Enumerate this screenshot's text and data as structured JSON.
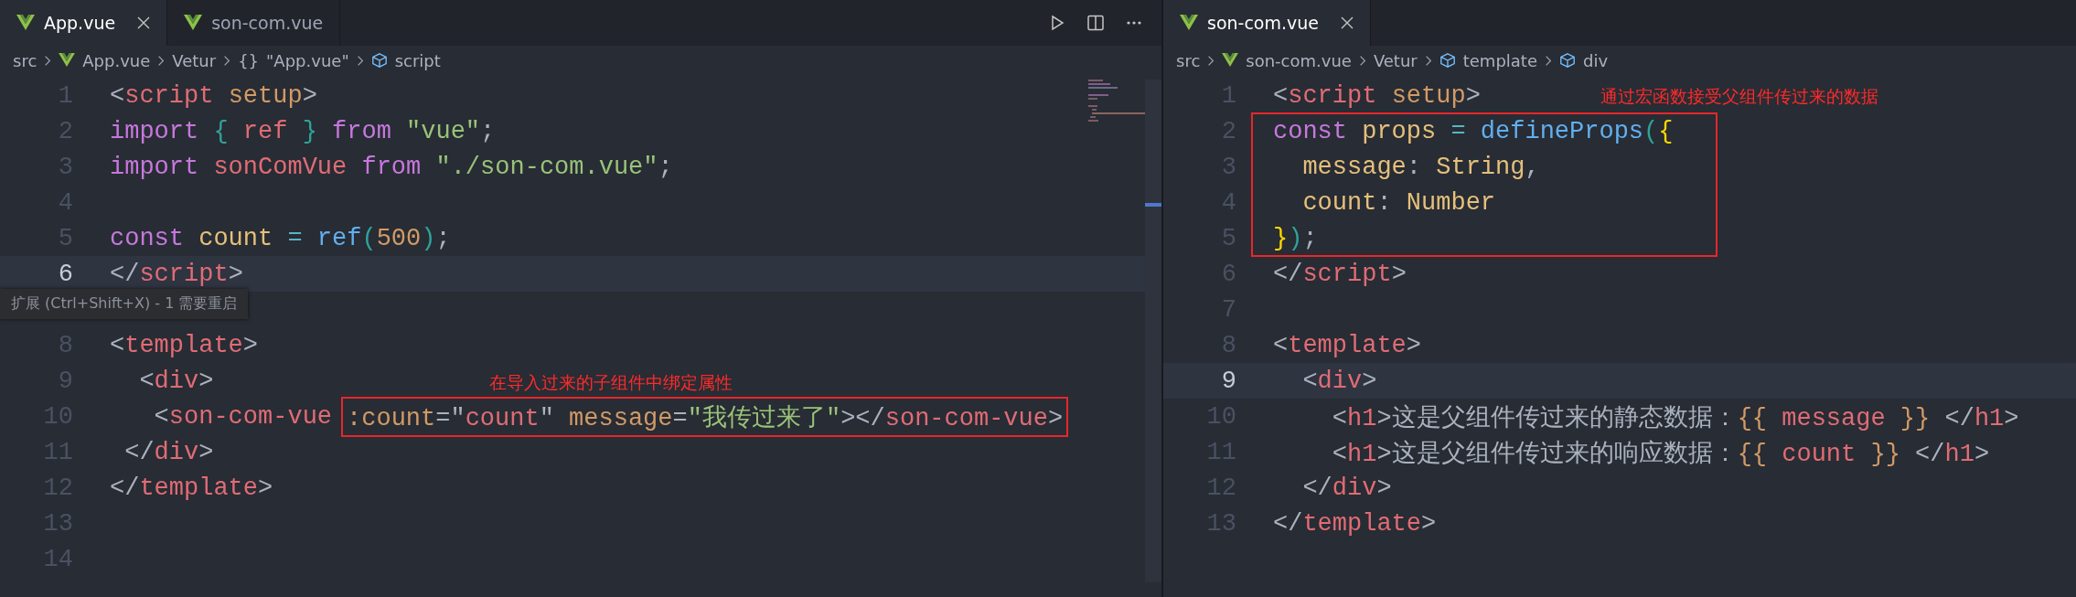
{
  "panes": [
    {
      "tabs": [
        {
          "label": "App.vue",
          "selected": true
        },
        {
          "label": "son-com.vue",
          "selected": false
        }
      ],
      "toolbar": true,
      "breadcrumbs": [
        {
          "kind": "folder",
          "text": "src"
        },
        {
          "kind": "file",
          "text": "App.vue"
        },
        {
          "kind": "plain",
          "text": "Vetur"
        },
        {
          "kind": "object",
          "glyph": "{}",
          "text": "\"App.vue\""
        },
        {
          "kind": "element",
          "text": "script"
        }
      ],
      "minimap": true,
      "tooltip": "扩展 (Ctrl+Shift+X) - 1 需要重启",
      "blocks": [
        {
          "lines": [
            {
              "number": "1",
              "current": false,
              "parts": [
                {
                  "tokens": [
                    {
                      "kind": "punct",
                      "text": "<"
                    },
                    {
                      "kind": "tag",
                      "text": "script "
                    },
                    {
                      "kind": "attr",
                      "text": "setup"
                    },
                    {
                      "kind": "punct",
                      "text": ">"
                    }
                  ]
                }
              ]
            },
            {
              "number": "2",
              "current": false,
              "parts": [
                {
                  "tokens": [
                    {
                      "kind": "keyword",
                      "text": "import "
                    },
                    {
                      "kind": "paren",
                      "text": "{ "
                    },
                    {
                      "kind": "tag",
                      "text": "ref "
                    },
                    {
                      "kind": "paren",
                      "text": "} "
                    },
                    {
                      "kind": "keyword",
                      "text": "from "
                    },
                    {
                      "kind": "string",
                      "text": "\"vue\""
                    },
                    {
                      "kind": "punct",
                      "text": ";"
                    }
                  ]
                }
              ]
            },
            {
              "number": "3",
              "current": false,
              "parts": [
                {
                  "tokens": [
                    {
                      "kind": "keyword",
                      "text": "import "
                    },
                    {
                      "kind": "tag",
                      "text": "sonComVue "
                    },
                    {
                      "kind": "keyword",
                      "text": "from "
                    },
                    {
                      "kind": "string",
                      "text": "\"./son-com.vue\""
                    },
                    {
                      "kind": "punct",
                      "text": ";"
                    }
                  ]
                }
              ]
            },
            {
              "number": "4",
              "current": false
            },
            {
              "number": "5",
              "current": false,
              "parts": [
                {
                  "tokens": [
                    {
                      "kind": "keyword",
                      "text": "const "
                    },
                    {
                      "kind": "var",
                      "text": "count "
                    },
                    {
                      "kind": "op",
                      "text": "= "
                    },
                    {
                      "kind": "func",
                      "text": "ref"
                    },
                    {
                      "kind": "paren",
                      "text": "("
                    },
                    {
                      "kind": "number",
                      "text": "500"
                    },
                    {
                      "kind": "paren",
                      "text": ")"
                    },
                    {
                      "kind": "punct",
                      "text": ";"
                    }
                  ]
                }
              ]
            },
            {
              "number": "6",
              "current": true,
              "parts": [
                {
                  "tokens": [
                    {
                      "kind": "punct",
                      "text": "</"
                    },
                    {
                      "kind": "tag",
                      "text": "script"
                    },
                    {
                      "kind": "punct",
                      "text": ">"
                    }
                  ]
                }
              ]
            },
            {
              "current": false
            },
            {
              "number": "8",
              "current": false,
              "parts": [
                {
                  "tokens": [
                    {
                      "kind": "punct",
                      "text": "<"
                    },
                    {
                      "kind": "tag",
                      "text": "template"
                    },
                    {
                      "kind": "punct",
                      "text": ">"
                    }
                  ]
                }
              ]
            },
            {
              "number": "9",
              "current": false,
              "parts": [
                {
                  "tokens": [
                    {
                      "kind": "punct",
                      "text": "  <"
                    },
                    {
                      "kind": "tag",
                      "text": "div"
                    },
                    {
                      "kind": "punct",
                      "text": ">"
                    }
                  ]
                }
              ]
            },
            {
              "number": "10",
              "current": false,
              "parts": [
                {
                  "tokens": [
                    {
                      "kind": "punct",
                      "text": "   <"
                    },
                    {
                      "kind": "tag",
                      "text": "son-com-vue"
                    }
                  ]
                },
                {
                  "boxed": true,
                  "note": "在导入过来的子组件中绑定属性",
                  "tokens": [
                    {
                      "kind": "attr",
                      "text": ":count"
                    },
                    {
                      "kind": "punct",
                      "text": "=\""
                    },
                    {
                      "kind": "tag",
                      "text": "count"
                    },
                    {
                      "kind": "punct",
                      "text": "\" "
                    },
                    {
                      "kind": "attr",
                      "text": "message"
                    },
                    {
                      "kind": "punct",
                      "text": "="
                    },
                    {
                      "kind": "string",
                      "text": "\"我传过来了\""
                    },
                    {
                      "kind": "punct",
                      "text": "></"
                    },
                    {
                      "kind": "tag",
                      "text": "son-com-vue"
                    },
                    {
                      "kind": "punct",
                      "text": ">"
                    }
                  ]
                }
              ]
            },
            {
              "number": "11",
              "current": false,
              "parts": [
                {
                  "tokens": [
                    {
                      "kind": "punct",
                      "text": " </"
                    },
                    {
                      "kind": "tag",
                      "text": "div"
                    },
                    {
                      "kind": "punct",
                      "text": ">"
                    }
                  ]
                }
              ]
            },
            {
              "number": "12",
              "current": false,
              "parts": [
                {
                  "tokens": [
                    {
                      "kind": "punct",
                      "text": "</"
                    },
                    {
                      "kind": "tag",
                      "text": "template"
                    },
                    {
                      "kind": "punct",
                      "text": ">"
                    }
                  ]
                }
              ]
            },
            {
              "number": "13",
              "current": false
            },
            {
              "number": "14",
              "current": false
            }
          ]
        }
      ]
    },
    {
      "tabs": [
        {
          "label": "son-com.vue",
          "selected": true
        }
      ],
      "breadcrumbs": [
        {
          "kind": "folder",
          "text": "src"
        },
        {
          "kind": "file",
          "text": "son-com.vue"
        },
        {
          "kind": "plain",
          "text": "Vetur"
        },
        {
          "kind": "element",
          "text": "template"
        },
        {
          "kind": "element",
          "text": "div"
        }
      ],
      "blocks": [
        {
          "lines": [
            {
              "number": "1",
              "current": false,
              "parts": [
                {
                  "tokens": [
                    {
                      "kind": "punct",
                      "text": "<"
                    },
                    {
                      "kind": "tag",
                      "text": "script "
                    },
                    {
                      "kind": "attr",
                      "text": "setup"
                    },
                    {
                      "kind": "punct",
                      "text": ">"
                    }
                  ]
                }
              ]
            }
          ]
        },
        {
          "boxed": true,
          "note": "通过宏函数接受父组件传过来的数据",
          "lines": [
            {
              "number": "2",
              "current": false,
              "parts": [
                {
                  "tokens": [
                    {
                      "kind": "keyword",
                      "text": "const "
                    },
                    {
                      "kind": "var",
                      "text": "props "
                    },
                    {
                      "kind": "op",
                      "text": "= "
                    },
                    {
                      "kind": "func",
                      "text": "defineProps"
                    },
                    {
                      "kind": "paren",
                      "text": "("
                    },
                    {
                      "kind": "brace",
                      "text": "{"
                    }
                  ]
                }
              ]
            },
            {
              "number": "3",
              "current": false,
              "parts": [
                {
                  "tokens": [
                    {
                      "kind": "var",
                      "text": "  message"
                    },
                    {
                      "kind": "punct",
                      "text": ": "
                    },
                    {
                      "kind": "var",
                      "text": "String"
                    },
                    {
                      "kind": "punct",
                      "text": ","
                    }
                  ]
                }
              ]
            },
            {
              "number": "4",
              "current": false,
              "parts": [
                {
                  "tokens": [
                    {
                      "kind": "var",
                      "text": "  count"
                    },
                    {
                      "kind": "punct",
                      "text": ": "
                    },
                    {
                      "kind": "var",
                      "text": "Number"
                    }
                  ]
                }
              ]
            },
            {
              "number": "5",
              "current": false,
              "parts": [
                {
                  "tokens": [
                    {
                      "kind": "brace",
                      "text": "}"
                    },
                    {
                      "kind": "paren",
                      "text": ")"
                    },
                    {
                      "kind": "punct",
                      "text": ";"
                    }
                  ]
                }
              ]
            }
          ]
        },
        {
          "lines": [
            {
              "number": "6",
              "current": false,
              "parts": [
                {
                  "tokens": [
                    {
                      "kind": "punct",
                      "text": "</"
                    },
                    {
                      "kind": "tag",
                      "text": "script"
                    },
                    {
                      "kind": "punct",
                      "text": ">"
                    }
                  ]
                }
              ]
            },
            {
              "number": "7",
              "current": false
            },
            {
              "number": "8",
              "current": false,
              "parts": [
                {
                  "tokens": [
                    {
                      "kind": "punct",
                      "text": "<"
                    },
                    {
                      "kind": "tag",
                      "text": "template"
                    },
                    {
                      "kind": "punct",
                      "text": ">"
                    }
                  ]
                }
              ]
            },
            {
              "number": "9",
              "current": true,
              "parts": [
                {
                  "tokens": [
                    {
                      "kind": "punct",
                      "text": "  <"
                    },
                    {
                      "kind": "tag",
                      "text": "div"
                    },
                    {
                      "kind": "punct",
                      "text": ">"
                    }
                  ]
                }
              ]
            },
            {
              "number": "10",
              "current": false,
              "parts": [
                {
                  "tokens": [
                    {
                      "kind": "punct",
                      "text": "    <"
                    },
                    {
                      "kind": "tag",
                      "text": "h1"
                    },
                    {
                      "kind": "punct",
                      "text": ">这是父组件传过来的静态数据："
                    },
                    {
                      "kind": "mustache",
                      "text": "{{ "
                    },
                    {
                      "kind": "tag",
                      "text": "message "
                    },
                    {
                      "kind": "mustache",
                      "text": "}} "
                    },
                    {
                      "kind": "punct",
                      "text": "</"
                    },
                    {
                      "kind": "tag",
                      "text": "h1"
                    },
                    {
                      "kind": "punct",
                      "text": ">"
                    }
                  ]
                }
              ]
            },
            {
              "number": "11",
              "current": false,
              "parts": [
                {
                  "tokens": [
                    {
                      "kind": "punct",
                      "text": "    <"
                    },
                    {
                      "kind": "tag",
                      "text": "h1"
                    },
                    {
                      "kind": "punct",
                      "text": ">这是父组件传过来的响应数据："
                    },
                    {
                      "kind": "mustache",
                      "text": "{{ "
                    },
                    {
                      "kind": "tag",
                      "text": "count "
                    },
                    {
                      "kind": "mustache",
                      "text": "}} "
                    },
                    {
                      "kind": "punct",
                      "text": "</"
                    },
                    {
                      "kind": "tag",
                      "text": "h1"
                    },
                    {
                      "kind": "punct",
                      "text": ">"
                    }
                  ]
                }
              ]
            },
            {
              "number": "12",
              "current": false,
              "parts": [
                {
                  "tokens": [
                    {
                      "kind": "punct",
                      "text": "  </"
                    },
                    {
                      "kind": "tag",
                      "text": "div"
                    },
                    {
                      "kind": "punct",
                      "text": ">"
                    }
                  ]
                }
              ]
            },
            {
              "number": "13",
              "current": false,
              "parts": [
                {
                  "tokens": [
                    {
                      "kind": "punct",
                      "text": "</"
                    },
                    {
                      "kind": "tag",
                      "text": "template"
                    },
                    {
                      "kind": "punct",
                      "text": ">"
                    }
                  ]
                }
              ]
            }
          ]
        }
      ]
    }
  ]
}
